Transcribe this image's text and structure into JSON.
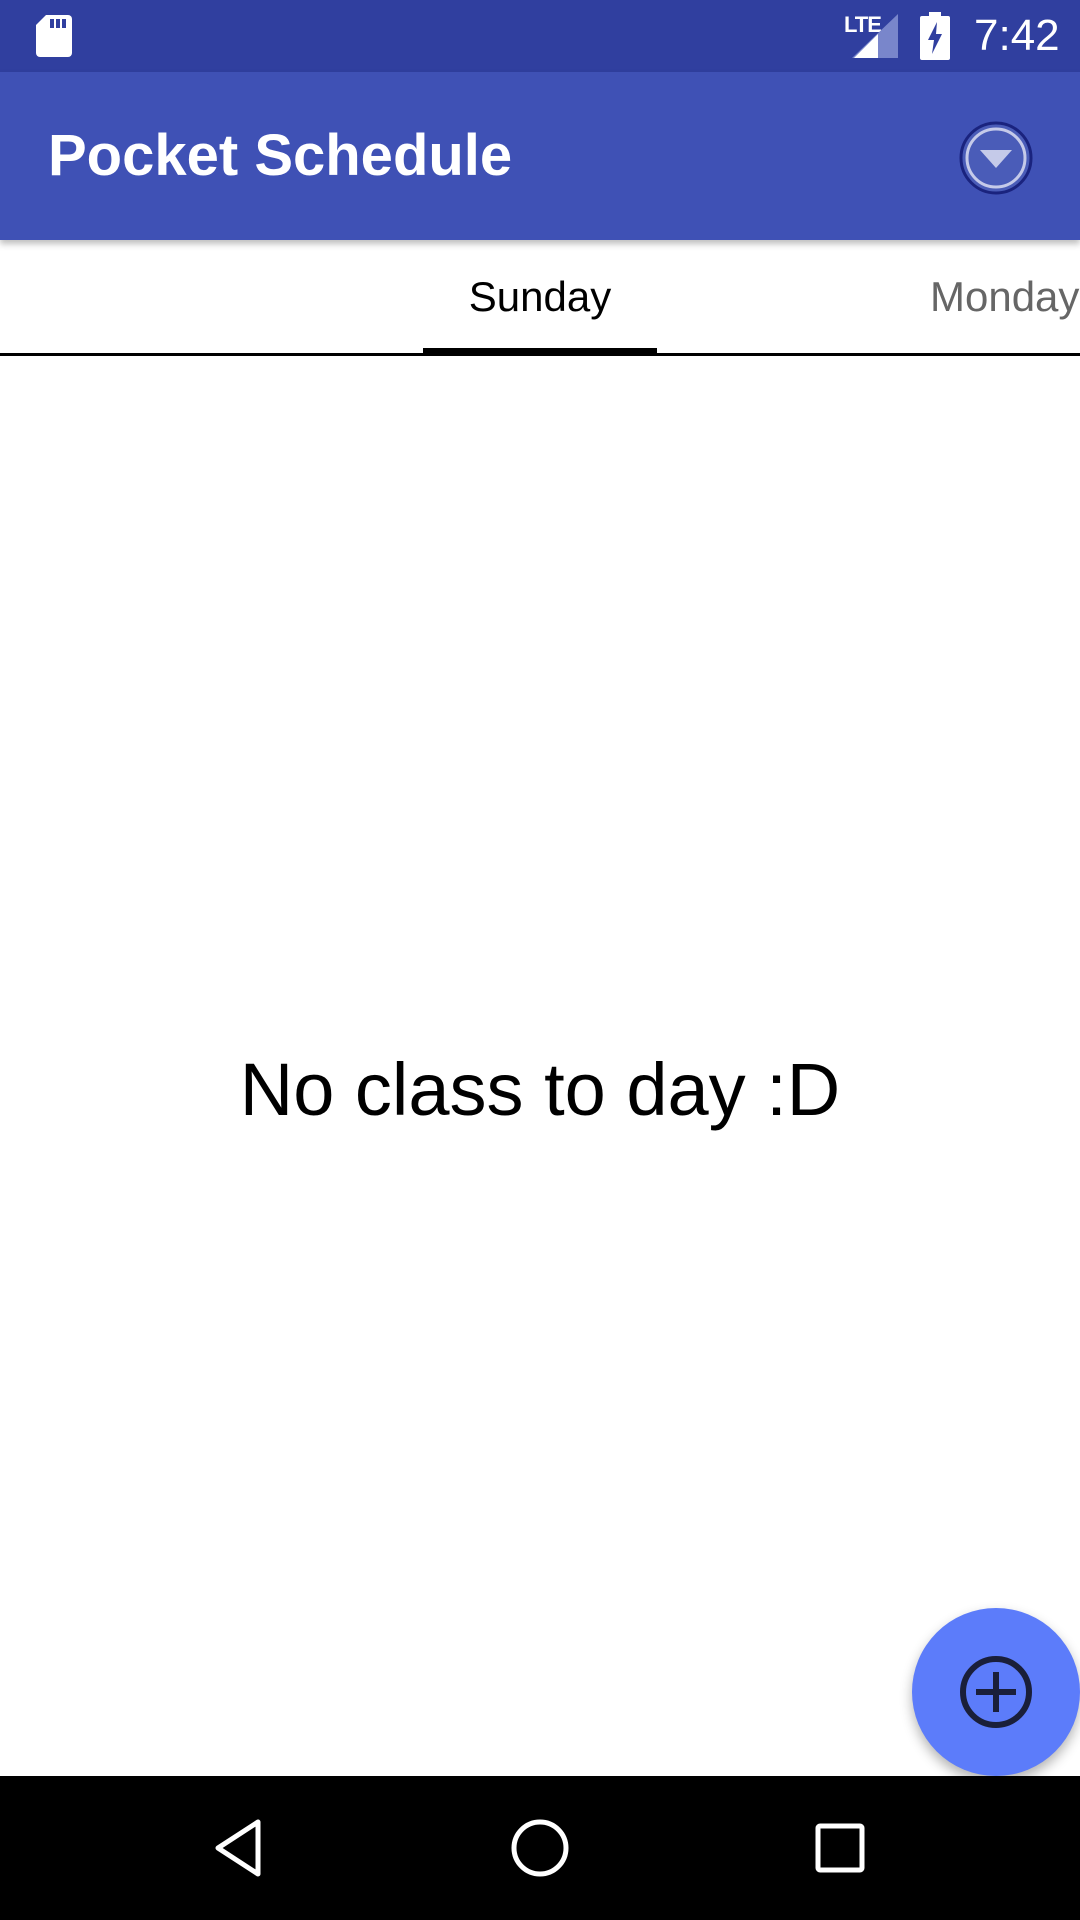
{
  "status_bar": {
    "network": "LTE",
    "time": "7:42",
    "icons": [
      "sd-card-icon",
      "signal-icon",
      "battery-charging-icon"
    ]
  },
  "app_bar": {
    "title": "Pocket Schedule",
    "menu_icon": "dropdown-circle-icon"
  },
  "tabs": {
    "items": [
      {
        "label": "Sunday",
        "selected": true
      },
      {
        "label": "Monday",
        "selected": false
      }
    ]
  },
  "content": {
    "empty_message": "No class to day :D"
  },
  "fab": {
    "icon": "add-circle-icon"
  },
  "navigation_bar": {
    "buttons": [
      "back-icon",
      "home-icon",
      "recents-icon"
    ]
  },
  "colors": {
    "status_bar": "#303F9F",
    "app_bar": "#3F51B5",
    "fab": "#5C7CFA",
    "tab_selected_text": "#000000",
    "tab_unselected_text": "#666666"
  }
}
